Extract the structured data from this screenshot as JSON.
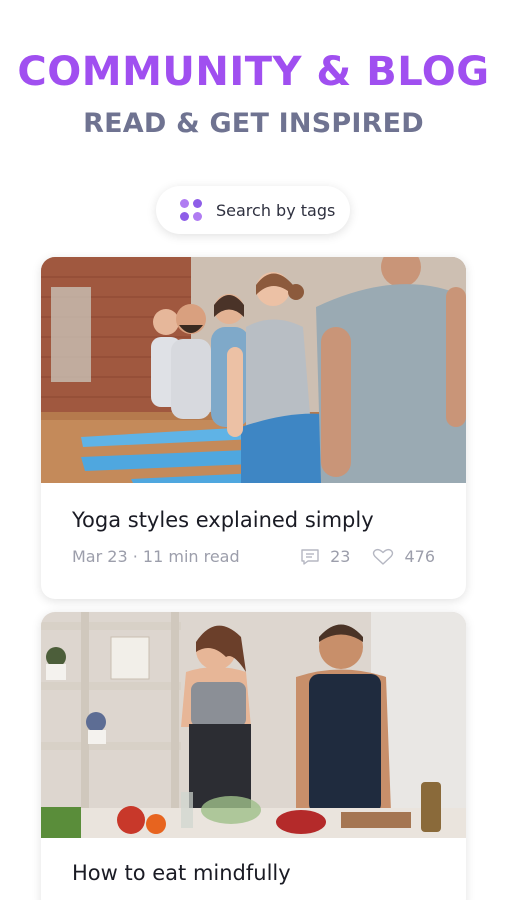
{
  "header": {
    "title": "COMMUNITY & BLOG",
    "subtitle": "READ & GET INSPIRED"
  },
  "search": {
    "label": "Search by tags",
    "icon": "tags-grid-icon"
  },
  "articles": [
    {
      "title": "Yoga styles explained simply",
      "date": "Mar 23",
      "read_time": "11 min read",
      "comments": "23",
      "likes": "476",
      "image": "yoga-class-photo"
    },
    {
      "title": "How to eat mindfully",
      "image": "couple-cooking-photo"
    }
  ],
  "colors": {
    "brand_purple": "#a04ff0",
    "subtitle_gray": "#6f7391",
    "meta_gray": "#9c9eab",
    "title_dark": "#1a1b24"
  }
}
